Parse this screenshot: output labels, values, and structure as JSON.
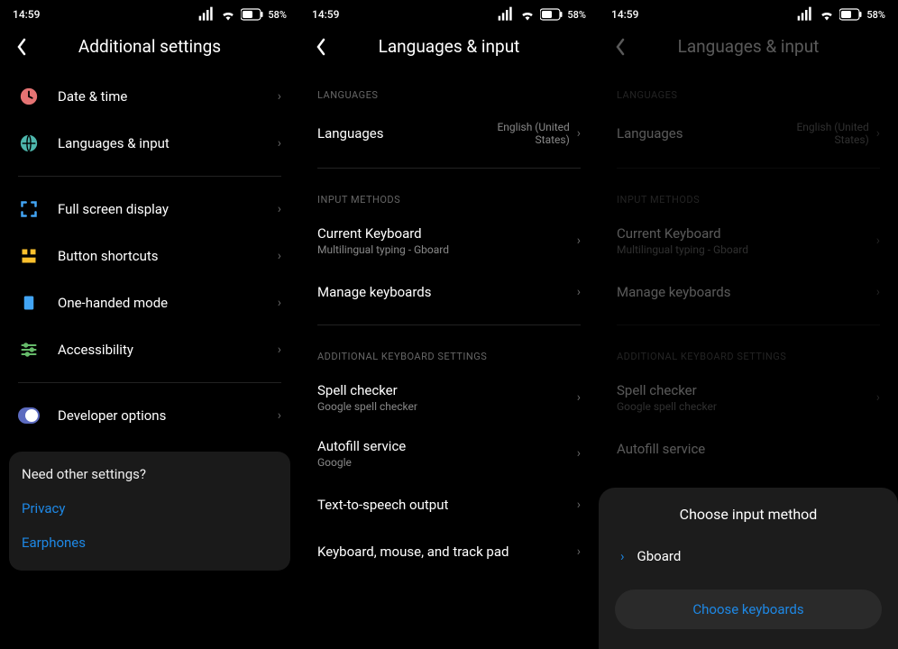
{
  "status": {
    "time": "14:59",
    "battery": "58"
  },
  "screen1": {
    "title": "Additional settings",
    "items": [
      {
        "label": "Date & time"
      },
      {
        "label": "Languages & input"
      },
      {
        "label": "Full screen display"
      },
      {
        "label": "Button shortcuts"
      },
      {
        "label": "One-handed mode"
      },
      {
        "label": "Accessibility"
      },
      {
        "label": "Developer options"
      }
    ],
    "card": {
      "title": "Need other settings?",
      "links": [
        "Privacy",
        "Earphones"
      ]
    }
  },
  "screen2": {
    "title": "Languages & input",
    "sections": {
      "languages": {
        "header": "LANGUAGES",
        "items": [
          {
            "label": "Languages",
            "value": "English (United States)"
          }
        ]
      },
      "input": {
        "header": "INPUT METHODS",
        "items": [
          {
            "label": "Current Keyboard",
            "sub": "Multilingual typing - Gboard"
          },
          {
            "label": "Manage keyboards"
          }
        ]
      },
      "additional": {
        "header": "ADDITIONAL KEYBOARD SETTINGS",
        "items": [
          {
            "label": "Spell checker",
            "sub": "Google spell checker"
          },
          {
            "label": "Autofill service",
            "sub": "Google"
          },
          {
            "label": "Text-to-speech output"
          },
          {
            "label": "Keyboard, mouse, and track pad"
          }
        ]
      }
    }
  },
  "screen3": {
    "sheet": {
      "title": "Choose input method",
      "option": "Gboard",
      "button": "Choose keyboards"
    }
  }
}
